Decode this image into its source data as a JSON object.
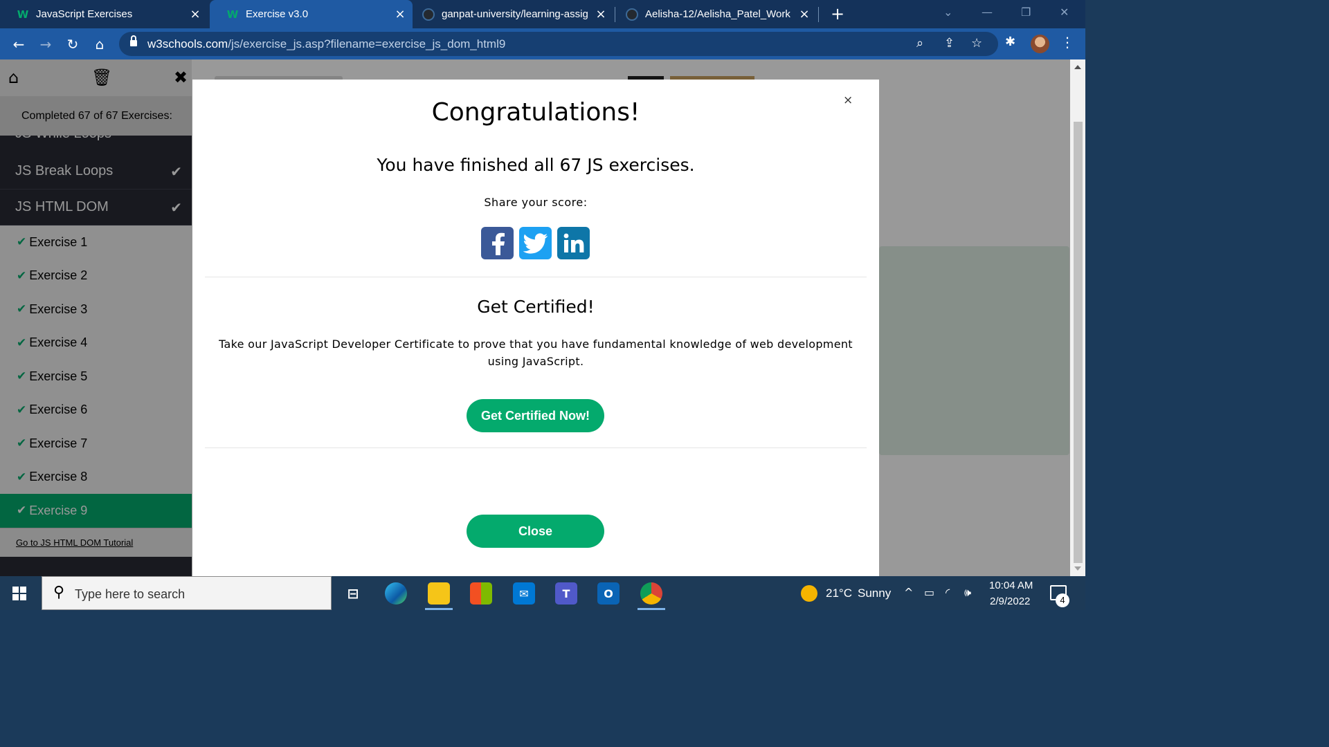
{
  "browser": {
    "tabs": [
      {
        "title": "JavaScript Exercises",
        "favicon": "w3schools-icon",
        "active": false
      },
      {
        "title": "Exercise v3.0",
        "favicon": "w3schools-icon",
        "active": true
      },
      {
        "title": "ganpat-university/learning-assig",
        "favicon": "github-icon",
        "active": false
      },
      {
        "title": "Aelisha-12/Aelisha_Patel_Work",
        "favicon": "github-icon",
        "active": false
      }
    ],
    "url_host": "w3schools.com",
    "url_path": "/js/exercise_js.asp?filename=exercise_js_dom_html9"
  },
  "sidebar": {
    "progress_text": "Completed 67 of 67 Exercises:",
    "partial_section": "JS While Loops",
    "sections": [
      {
        "label": "JS Break Loops"
      },
      {
        "label": "JS HTML DOM"
      }
    ],
    "exercises": [
      "Exercise 1",
      "Exercise 2",
      "Exercise 3",
      "Exercise 4",
      "Exercise 5",
      "Exercise 6",
      "Exercise 7",
      "Exercise 8",
      "Exercise 9"
    ],
    "active_exercise": "Exercise 9",
    "tutorial_link": "Go to JS HTML DOM Tutorial"
  },
  "modal": {
    "title": "Congratulations!",
    "subtitle": "You have finished all 67 JS exercises.",
    "share_label": "Share your score:",
    "social": [
      "facebook-icon",
      "twitter-icon",
      "linkedin-icon"
    ],
    "cert_title": "Get Certified!",
    "cert_text": "Take our JavaScript Developer Certificate to prove that you have fundamental knowledge of web development using JavaScript.",
    "cert_button": "Get Certified Now!",
    "close_button": "Close",
    "close_glyph": "×"
  },
  "taskbar": {
    "search_placeholder": "Type here to search",
    "weather_temp": "21°C",
    "weather_cond": "Sunny",
    "time": "10:04 AM",
    "date": "2/9/2022",
    "notification_count": "4"
  },
  "colors": {
    "accent": "#04aa6d",
    "browser_frame": "#14325a",
    "browser_toolbar": "#1f5aa3",
    "sidebar_dark": "#282a35"
  }
}
